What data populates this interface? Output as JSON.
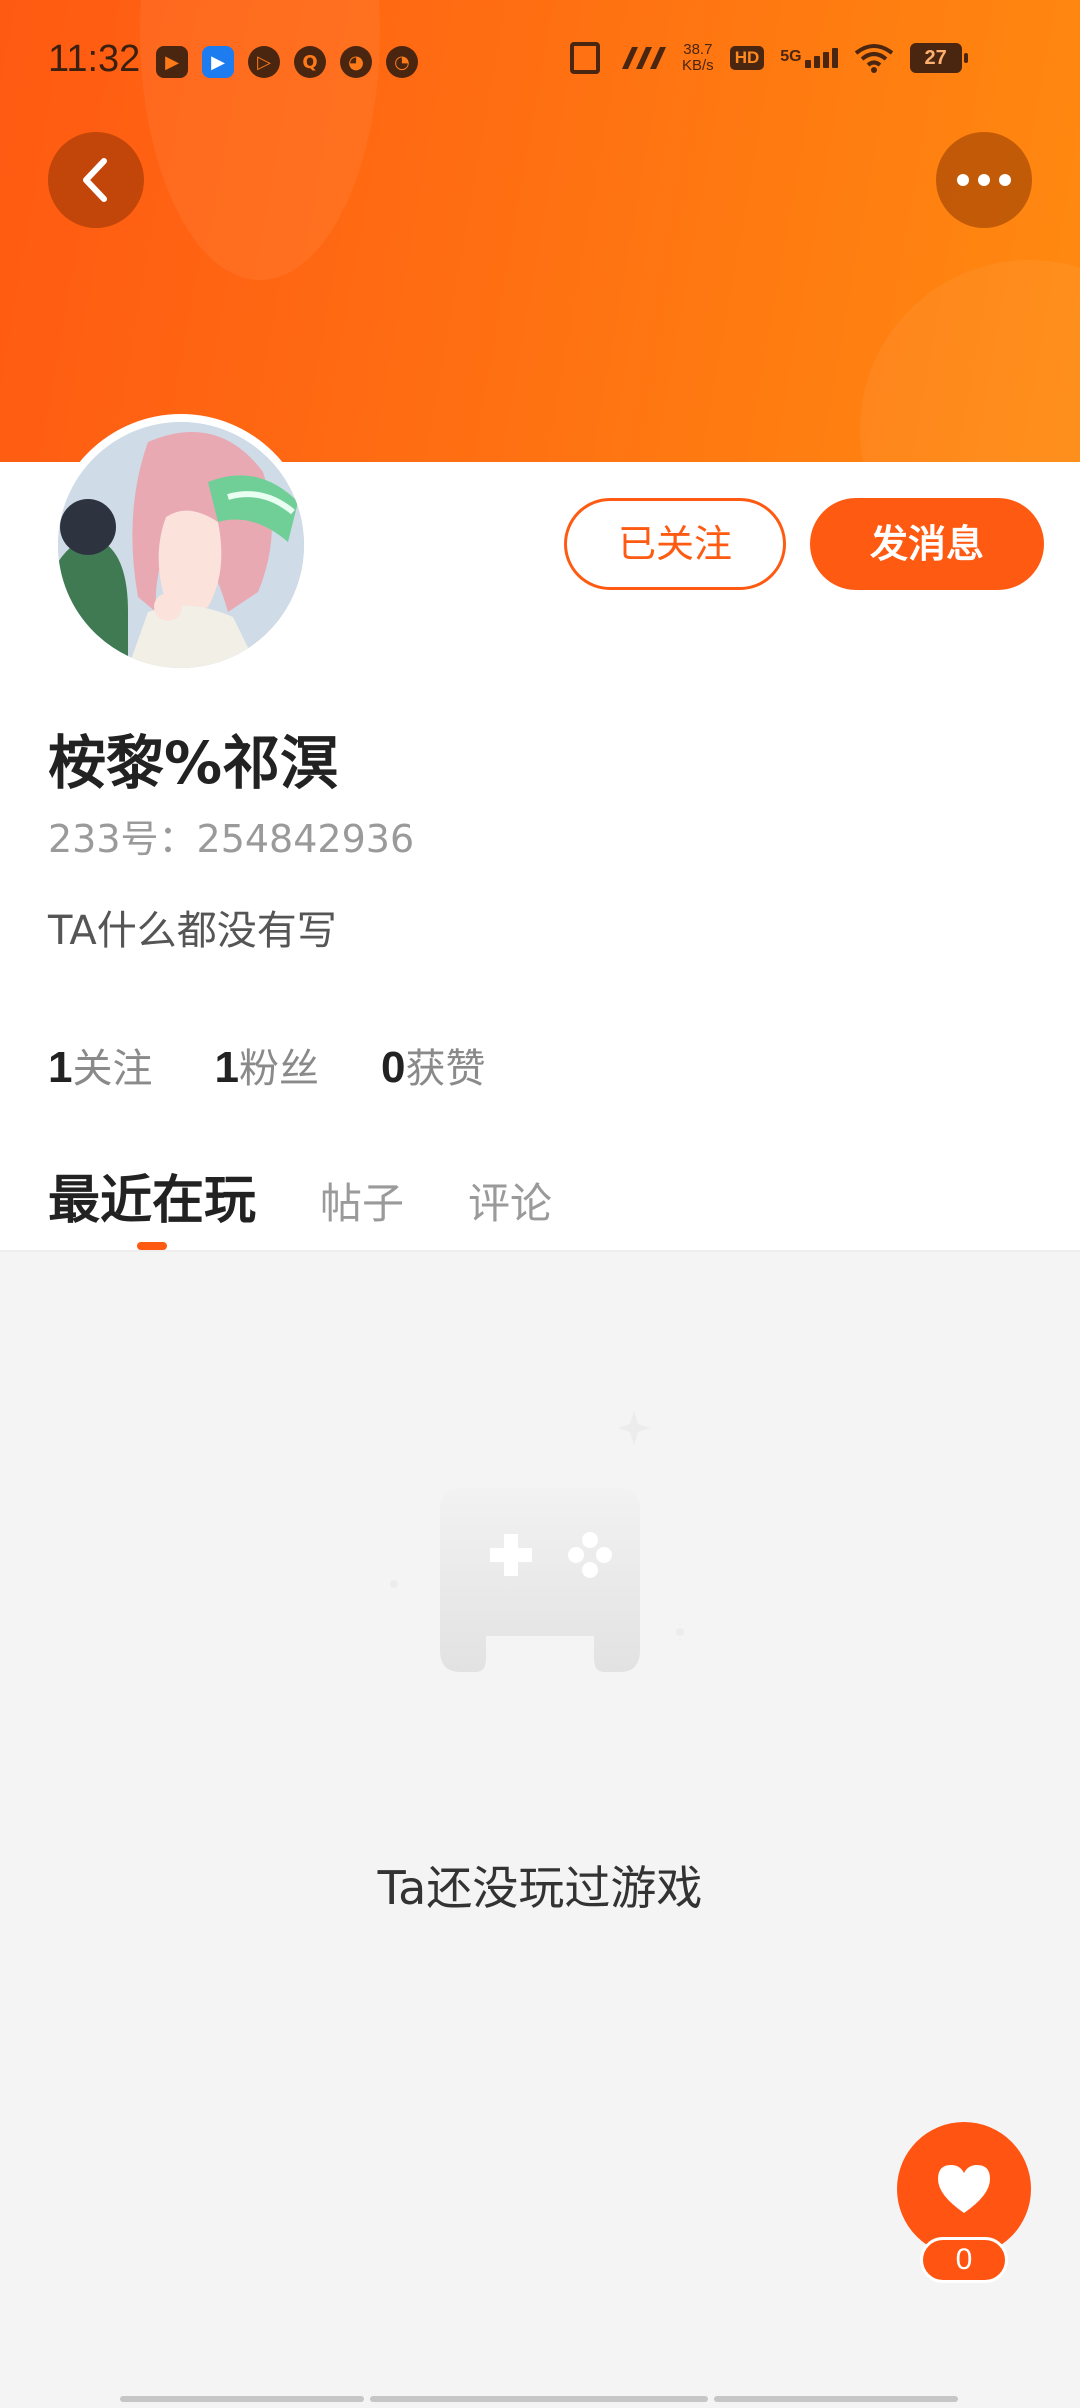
{
  "status_bar": {
    "time": "11:32",
    "net_speed_value": "38.7",
    "net_speed_unit": "KB/s",
    "hd_label": "HD",
    "network_label": "5G",
    "battery_level": "27"
  },
  "header": {
    "back_icon": "chevron-left-icon",
    "more_icon": "more-dots-icon",
    "accent_color": "#ff5a12"
  },
  "profile": {
    "nickname": "桉黎%祁溟",
    "uid_label": "233号：254842936",
    "bio": "TA什么都没有写",
    "follow_button": "已关注",
    "message_button": "发消息",
    "stats": [
      {
        "value": "1",
        "label": "关注"
      },
      {
        "value": "1",
        "label": "粉丝"
      },
      {
        "value": "0",
        "label": "获赞"
      }
    ]
  },
  "tabs": [
    {
      "label": "最近在玩",
      "active": true
    },
    {
      "label": "帖子",
      "active": false
    },
    {
      "label": "评论",
      "active": false
    }
  ],
  "empty_state": {
    "icon": "gamepad-icon",
    "message": "Ta还没玩过游戏"
  },
  "like": {
    "icon": "heart-icon",
    "count": "0"
  }
}
